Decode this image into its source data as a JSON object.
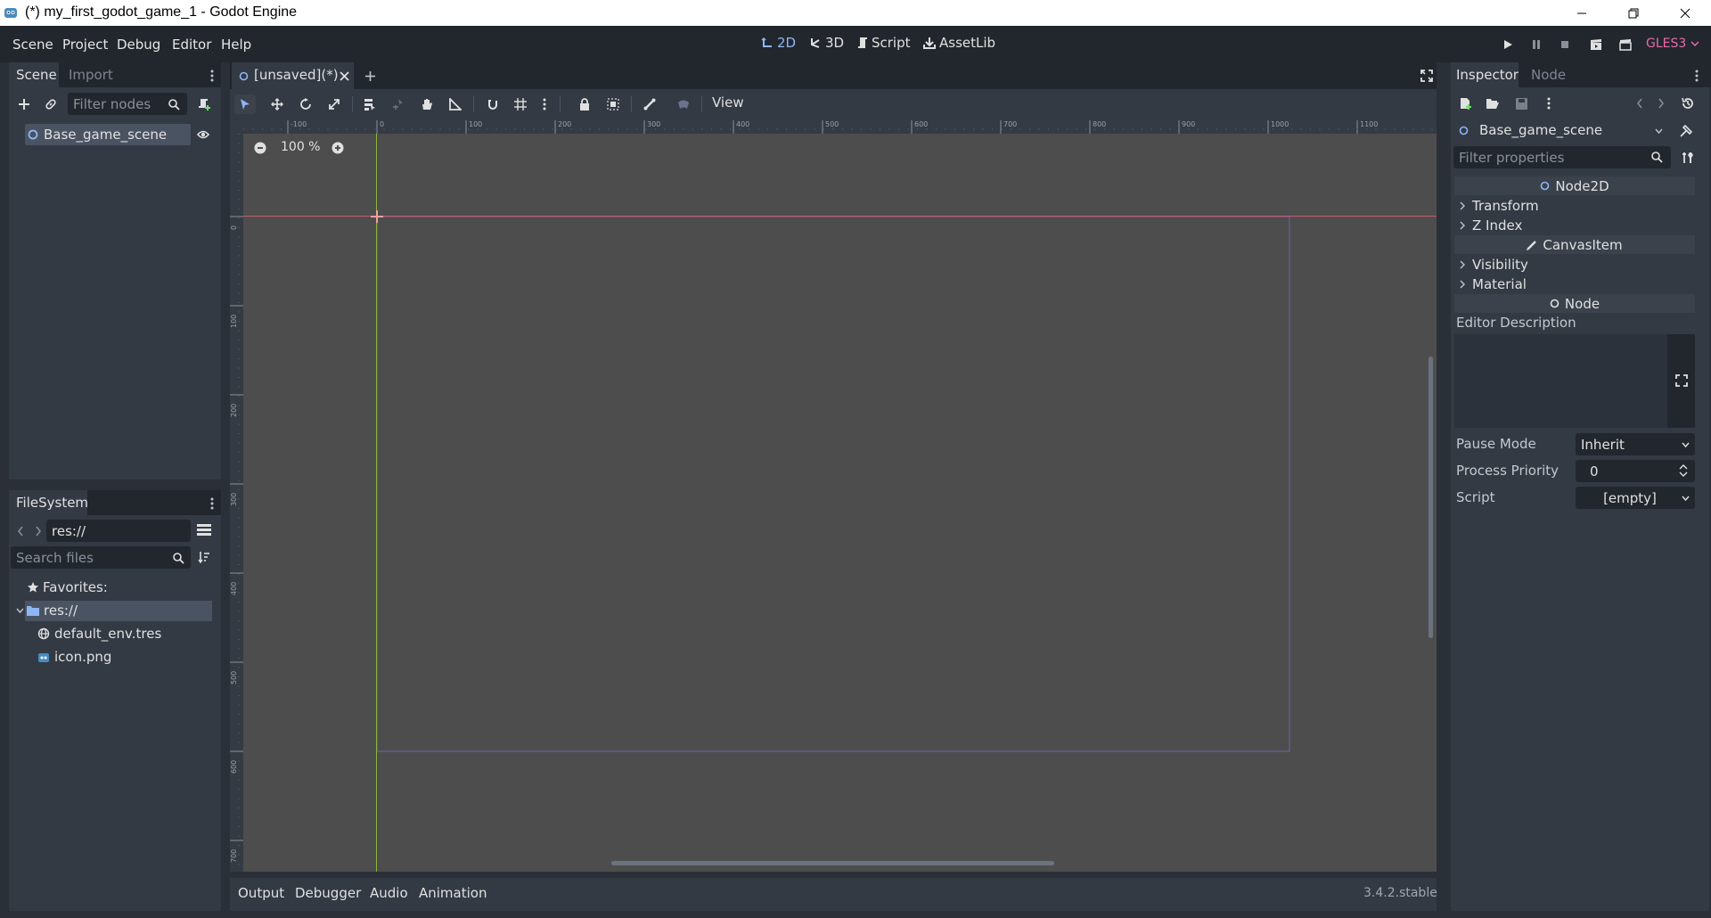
{
  "window": {
    "title": "(*) my_first_godot_game_1 - Godot Engine"
  },
  "menu": {
    "items": [
      "Scene",
      "Project",
      "Debug",
      "Editor",
      "Help"
    ]
  },
  "workspaces": {
    "items": [
      {
        "label": "2D",
        "icon": "2d-icon",
        "active": true
      },
      {
        "label": "3D",
        "icon": "3d-icon",
        "active": false
      },
      {
        "label": "Script",
        "icon": "script-icon",
        "active": false
      },
      {
        "label": "AssetLib",
        "icon": "assetlib-icon",
        "active": false
      }
    ]
  },
  "renderer": {
    "label": "GLES3",
    "color": "#e86aa8"
  },
  "scene_dock": {
    "tabs": [
      "Scene",
      "Import"
    ],
    "filter_placeholder": "Filter nodes",
    "tree": [
      {
        "label": "Base_game_scene",
        "icon": "node2d-icon",
        "selected": true,
        "visible": true
      }
    ]
  },
  "filesystem_dock": {
    "tab": "FileSystem",
    "path": "res://",
    "search_placeholder": "Search files",
    "tree": {
      "favorites": "Favorites:",
      "root": "res://",
      "files": [
        {
          "label": "default_env.tres",
          "icon": "environment-icon"
        },
        {
          "label": "icon.png",
          "icon": "image-icon"
        }
      ]
    }
  },
  "editor": {
    "scene_tab": "[unsaved](*)",
    "view_menu": "View",
    "zoom": "100 %",
    "ruler_h": [
      "-100",
      "0",
      "100",
      "200",
      "300",
      "400",
      "500",
      "600",
      "700",
      "800",
      "900",
      "1000",
      "1100"
    ],
    "ruler_v": [
      "0",
      "100",
      "200",
      "300",
      "400",
      "500",
      "600",
      "700"
    ]
  },
  "bottom_panel": {
    "tabs": [
      "Output",
      "Debugger",
      "Audio",
      "Animation"
    ],
    "version": "3.4.2.stable"
  },
  "inspector": {
    "tabs": [
      "Inspector",
      "Node"
    ],
    "object_name": "Base_game_scene",
    "filter_placeholder": "Filter properties",
    "sections": [
      {
        "type": "header",
        "label": "Node2D",
        "icon": "node2d-icon"
      },
      {
        "type": "group",
        "label": "Transform"
      },
      {
        "type": "group",
        "label": "Z Index"
      },
      {
        "type": "header",
        "label": "CanvasItem",
        "icon": "pencil-icon"
      },
      {
        "type": "group",
        "label": "Visibility"
      },
      {
        "type": "group",
        "label": "Material"
      },
      {
        "type": "header",
        "label": "Node",
        "icon": "node-icon"
      }
    ],
    "editor_description_label": "Editor Description",
    "properties": [
      {
        "label": "Pause Mode",
        "value": "Inherit",
        "control": "dropdown"
      },
      {
        "label": "Process Priority",
        "value": "0",
        "control": "spinbox"
      },
      {
        "label": "Script",
        "value": "[empty]",
        "control": "dropdown"
      }
    ]
  }
}
